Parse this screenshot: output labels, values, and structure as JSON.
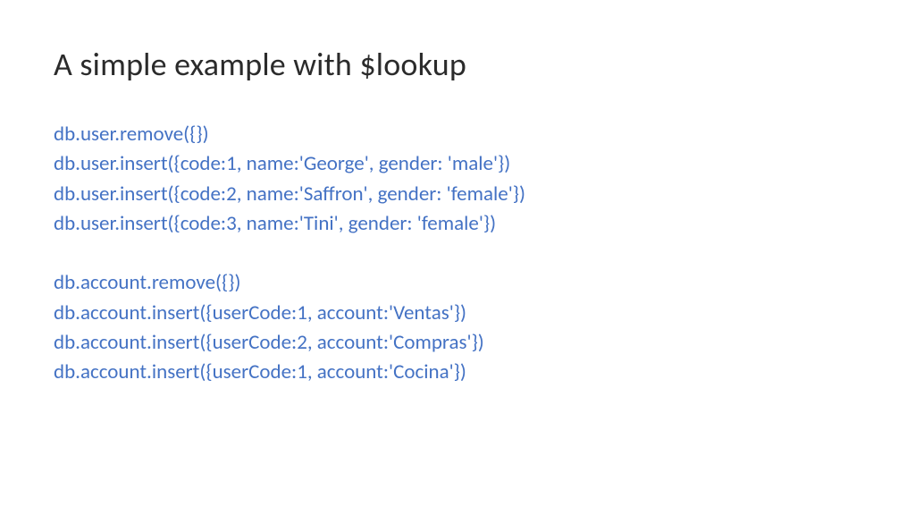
{
  "title": "A simple example with $lookup",
  "code": {
    "block1": [
      "db.user.remove({})",
      "db.user.insert({code:1, name:'George', gender: 'male'})",
      "db.user.insert({code:2, name:'Saffron', gender: 'female'})",
      "db.user.insert({code:3, name:'Tini', gender: 'female'})"
    ],
    "block2": [
      "db.account.remove({})",
      "db.account.insert({userCode:1, account:'Ventas'})",
      "db.account.insert({userCode:2, account:'Compras'})",
      "db.account.insert({userCode:1, account:'Cocina'})"
    ]
  }
}
